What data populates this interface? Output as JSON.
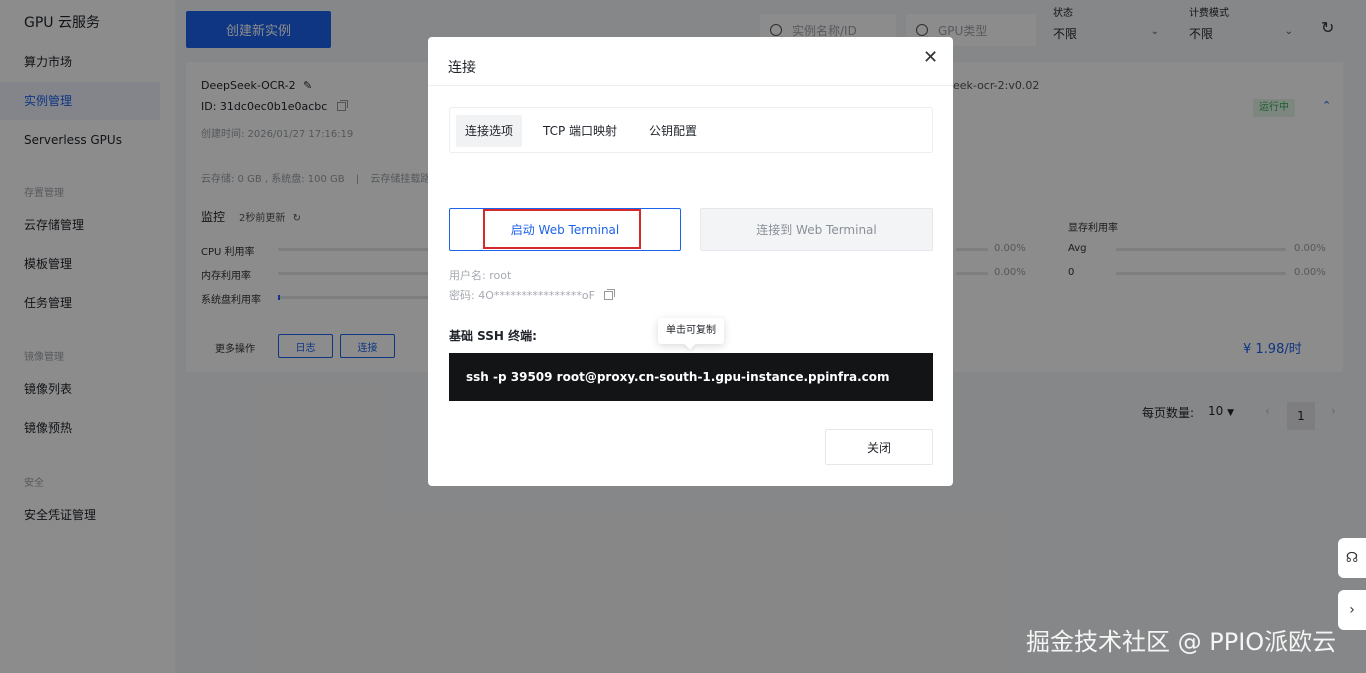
{
  "sidebar": {
    "brand": "GPU 云服务",
    "items": [
      {
        "label": "算力市场"
      },
      {
        "label": "实例管理",
        "active": true
      },
      {
        "label": "Serverless GPUs"
      },
      {
        "label": "云存储管理"
      },
      {
        "label": "模板管理"
      },
      {
        "label": "任务管理"
      },
      {
        "label": "镜像列表"
      },
      {
        "label": "镜像预热"
      },
      {
        "label": "安全凭证管理"
      }
    ],
    "groups": [
      "存置管理",
      "镜像管理",
      "安全"
    ]
  },
  "toolbar": {
    "create_label": "创建新实例",
    "search_name_placeholder": "实例名称/ID",
    "search_gpu_placeholder": "GPU类型",
    "status_label": "状态",
    "status_value": "不限",
    "billing_label": "计费模式",
    "billing_value": "不限"
  },
  "instance": {
    "name": "DeepSeek-OCR-2",
    "id": "ID: 31dc0ec0b1e0acbc",
    "created": "创建时间: 2026/01/27 17:16:19",
    "image_tail": "eek-ocr-2:v0.02",
    "status": "运行中",
    "storage": "云存储: 0 GB , 系统盘: 100 GB",
    "storage_extra": "云存储挂载路",
    "monitor_title": "监控",
    "monitor_refresh": "2秒前更新",
    "metrics": [
      {
        "label": "CPU 利用率"
      },
      {
        "label": "内存利用率"
      },
      {
        "label": "系统盘利用率"
      }
    ],
    "mid_pcts": [
      "0.00%",
      "0.00%"
    ],
    "vram": {
      "title": "显存利用率",
      "rows": [
        {
          "label": "Avg",
          "value": "0.00%"
        },
        {
          "label": "0",
          "value": "0.00%"
        }
      ]
    },
    "more_ops": "更多操作",
    "log_label": "日志",
    "connect_label": "连接",
    "price": "¥ 1.98/时"
  },
  "pager": {
    "per_page_label": "每页数量:",
    "per_page_value": "10",
    "current": "1"
  },
  "modal": {
    "title": "连接",
    "tabs": [
      {
        "label": "连接选项",
        "active": true
      },
      {
        "label": "TCP 端口映射"
      },
      {
        "label": "公钥配置"
      }
    ],
    "start_terminal": "启动 Web Terminal",
    "connect_terminal": "连接到 Web Terminal",
    "username": "用户名: root",
    "password": "密码: 4O****************oF",
    "ssh_label": "基础 SSH 终端:",
    "tooltip": "单击可复制",
    "ssh_command": "ssh -p 39509 root@proxy.cn-south-1.gpu-instance.ppinfra.com",
    "close_label": "关闭"
  },
  "watermark": "掘金技术社区 @ PPIO派欧云",
  "colors": {
    "accent": "#1d63ed",
    "highlight": "#d62a2a",
    "running": "#36a95b"
  }
}
